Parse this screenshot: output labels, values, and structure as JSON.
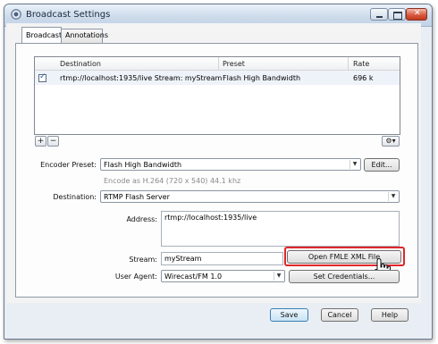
{
  "window": {
    "title": "Broadcast Settings",
    "icon": "wirecast-icon",
    "controls": {
      "minimize": "minimize-icon",
      "maximize": "maximize-icon",
      "close": "close-icon"
    }
  },
  "tabs": [
    {
      "label": "Broadcast",
      "active": true
    },
    {
      "label": "Annotations",
      "active": false
    }
  ],
  "list": {
    "columns": [
      "Destination",
      "Preset",
      "Rate"
    ],
    "rows": [
      {
        "checked": true,
        "destination": "rtmp://localhost:1935/live Stream: myStream",
        "preset": "Flash High Bandwidth",
        "rate": "696 k"
      }
    ],
    "add_label": "+",
    "remove_label": "−",
    "gear_label": "⚙▾"
  },
  "form": {
    "encoder_preset_label": "Encoder Preset:",
    "encoder_preset_value": "Flash High Bandwidth",
    "edit_label": "Edit...",
    "encode_hint": "Encode as H.264 (720 x 540) 44.1 khz",
    "destination_label": "Destination:",
    "destination_value": "RTMP Flash Server",
    "address_label": "Address:",
    "address_value": "rtmp://localhost:1935/live",
    "stream_label": "Stream:",
    "stream_value": "myStream",
    "open_fmle_label": "Open FMLE XML File",
    "user_agent_label": "User Agent:",
    "user_agent_value": "Wirecast/FM 1.0",
    "set_credentials_label": "Set Credentials..."
  },
  "footer": {
    "save": "Save",
    "cancel": "Cancel",
    "help": "Help"
  },
  "colors": {
    "highlight": "#e0262b",
    "accent": "#3c7fb1"
  }
}
